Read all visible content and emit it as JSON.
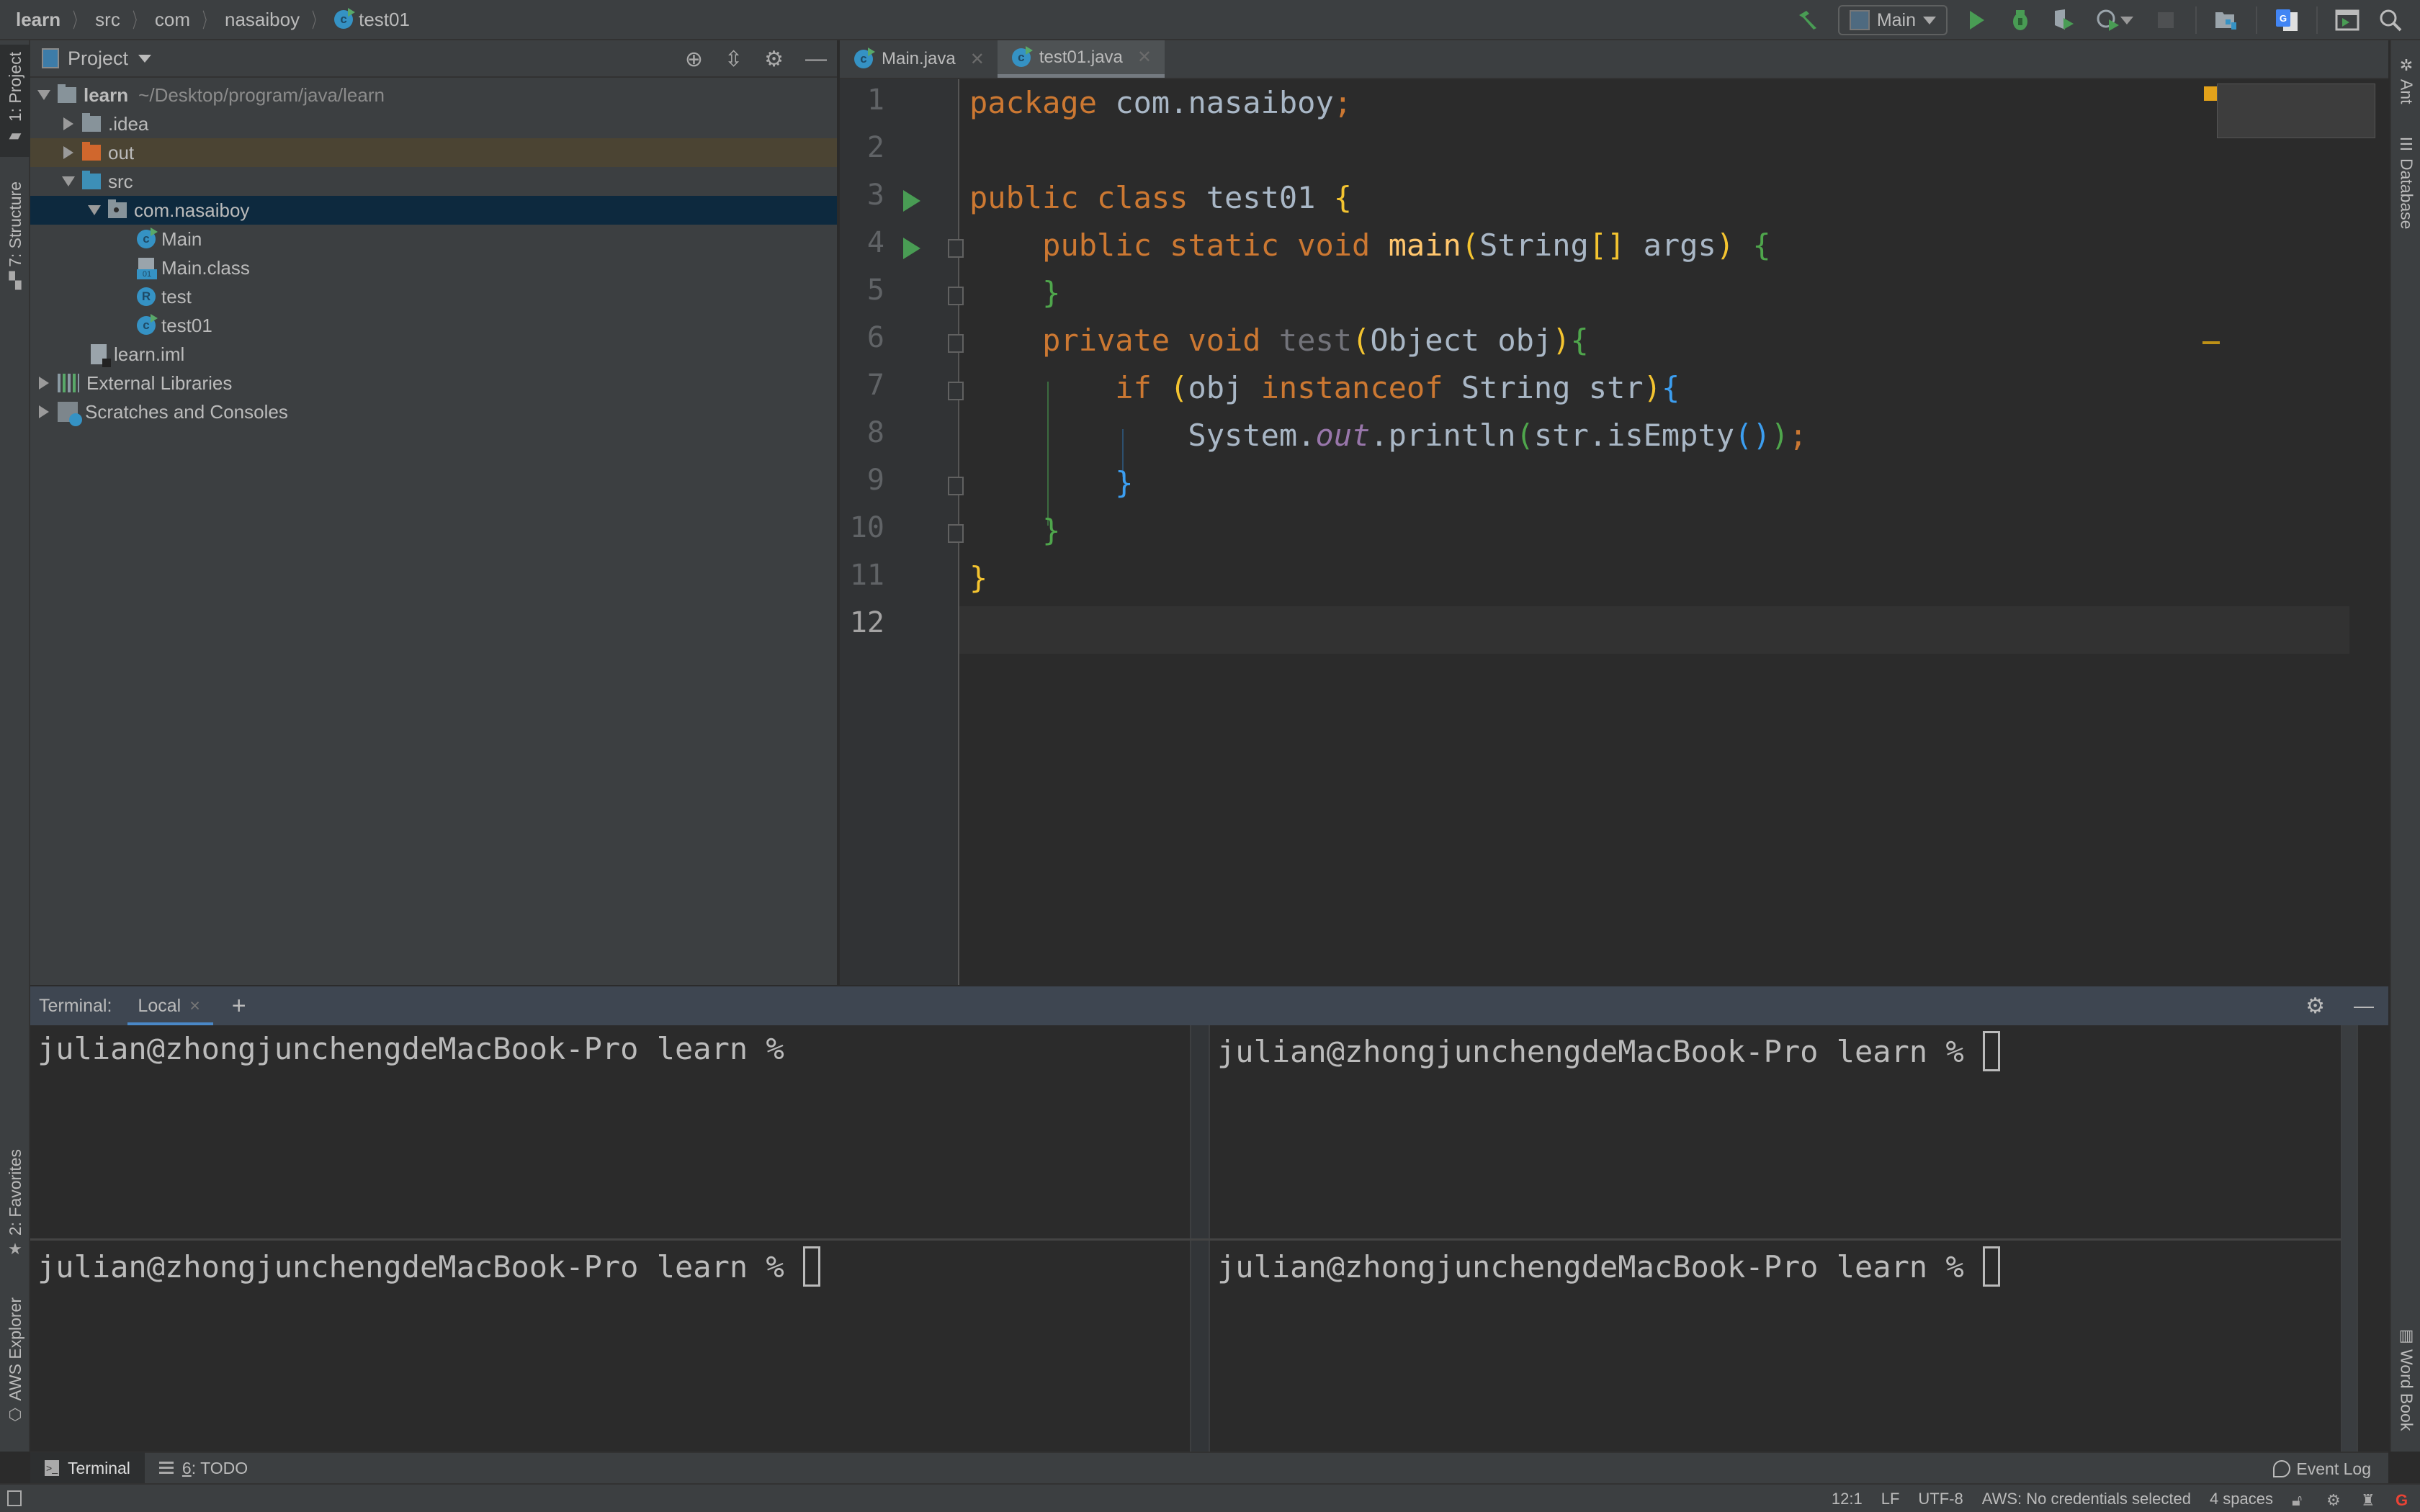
{
  "breadcrumb": [
    "learn",
    "src",
    "com",
    "nasaiboy",
    "test01"
  ],
  "toolbar": {
    "run_config": "Main",
    "icons": [
      "build-hammer-icon",
      "run-icon",
      "debug-icon",
      "coverage-icon",
      "profile-icon",
      "stop-icon",
      "project-structure-icon",
      "translate-icon",
      "run-anything-icon",
      "search-icon"
    ]
  },
  "left_strip": {
    "project_tab": "1: Project",
    "structure_tab": "7: Structure",
    "favorites_tab": "2: Favorites",
    "aws_tab": "AWS Explorer"
  },
  "right_strip": {
    "ant_tab": "Ant",
    "database_tab": "Database",
    "wordbook_tab": "Word Book"
  },
  "project": {
    "title": "Project",
    "tree": [
      {
        "label": "learn",
        "hint": "~/Desktop/program/java/learn",
        "depth": 0,
        "arrow": "down",
        "icon": "module-folder"
      },
      {
        "label": ".idea",
        "depth": 1,
        "arrow": "right",
        "icon": "folder"
      },
      {
        "label": "out",
        "depth": 1,
        "arrow": "right",
        "icon": "excluded-folder"
      },
      {
        "label": "src",
        "depth": 1,
        "arrow": "down",
        "icon": "source-folder"
      },
      {
        "label": "com.nasaiboy",
        "depth": 2,
        "arrow": "down",
        "icon": "package",
        "selected": true
      },
      {
        "label": "Main",
        "depth": 3,
        "icon": "class"
      },
      {
        "label": "Main.class",
        "depth": 3,
        "icon": "class-file"
      },
      {
        "label": "test",
        "depth": 3,
        "icon": "record"
      },
      {
        "label": "test01",
        "depth": 3,
        "icon": "class"
      },
      {
        "label": "learn.iml",
        "depth": 2,
        "icon": "iml-file"
      },
      {
        "label": "External Libraries",
        "depth": 0,
        "arrow": "right",
        "icon": "libraries"
      },
      {
        "label": "Scratches and Consoles",
        "depth": 0,
        "arrow": "right",
        "icon": "scratches"
      }
    ]
  },
  "editor": {
    "tabs": [
      {
        "label": "Main.java",
        "active": false
      },
      {
        "label": "test01.java",
        "active": true
      }
    ],
    "line_numbers": [
      "1",
      "2",
      "3",
      "4",
      "5",
      "6",
      "7",
      "8",
      "9",
      "10",
      "11",
      "12"
    ],
    "current_line": 12,
    "code_lines": [
      "package com.nasaiboy;",
      "",
      "public class test01 {",
      "    public static void main(String[] args) {",
      "    }",
      "    private void test(Object obj){",
      "        if (obj instanceof String str){",
      "            System.out.println(str.isEmpty());",
      "        }",
      "    }",
      "}",
      ""
    ]
  },
  "terminal": {
    "label": "Terminal:",
    "tab": "Local",
    "prompt": "julian@zhongjunchengdeMacBook-Pro learn %"
  },
  "bottom_bar": {
    "terminal": "Terminal",
    "todo_num": "6",
    "todo": ": TODO",
    "event_log": "Event Log"
  },
  "status": {
    "position": "12:1",
    "line_sep": "LF",
    "encoding": "UTF-8",
    "aws": "AWS: No credentials selected",
    "indent": "4 spaces"
  }
}
